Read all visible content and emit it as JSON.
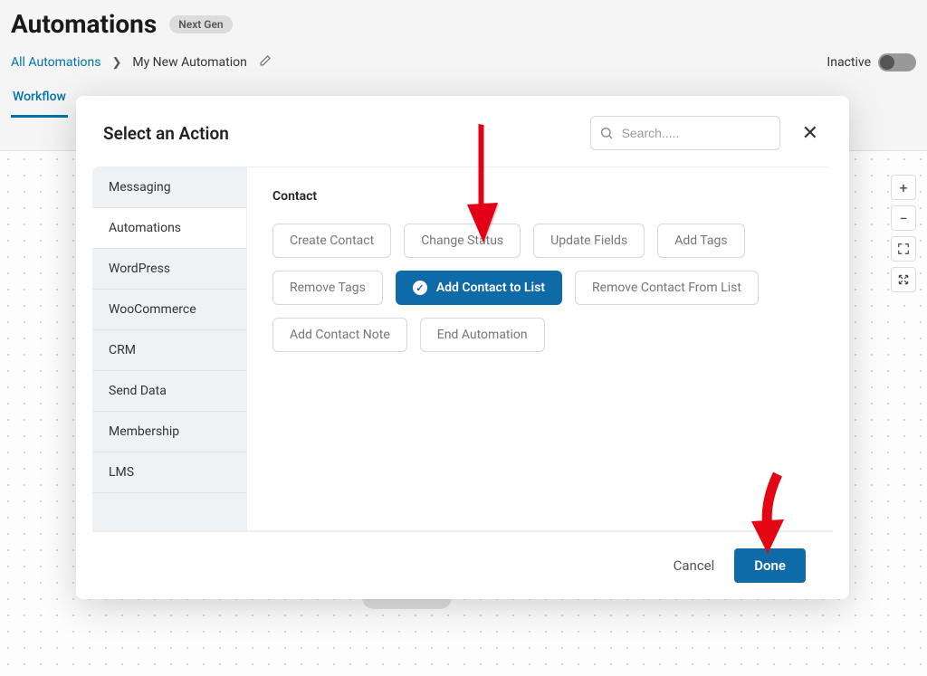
{
  "header": {
    "title": "Automations",
    "badge": "Next Gen"
  },
  "breadcrumb": {
    "root": "All Automations",
    "current": "My New Automation"
  },
  "status": {
    "label": "Inactive"
  },
  "tabs": {
    "active": "Workflow"
  },
  "modal": {
    "title": "Select an Action",
    "search_placeholder": "Search.....",
    "sidebar": {
      "items": [
        "Messaging",
        "Automations",
        "WordPress",
        "WooCommerce",
        "CRM",
        "Send Data",
        "Membership",
        "LMS"
      ]
    },
    "section": {
      "title": "Contact",
      "actions": [
        "Create Contact",
        "Change Status",
        "Update Fields",
        "Add Tags",
        "Remove Tags",
        "Add Contact to List",
        "Remove Contact From List",
        "Add Contact Note",
        "End Automation"
      ]
    },
    "footer": {
      "cancel": "Cancel",
      "done": "Done"
    }
  }
}
